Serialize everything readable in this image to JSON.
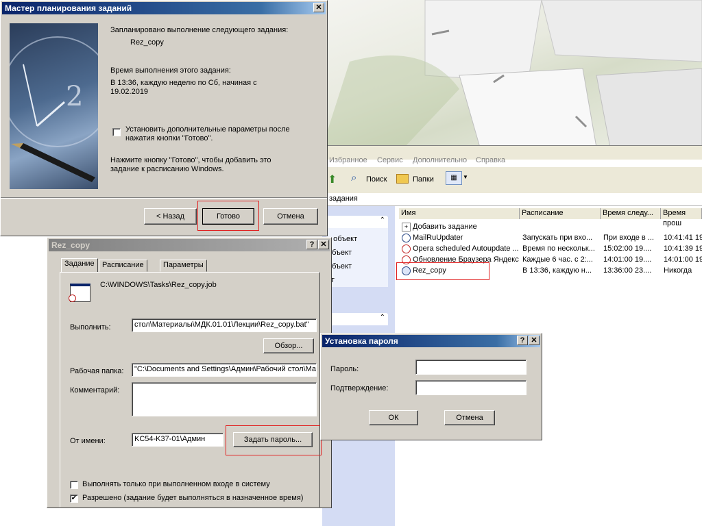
{
  "wizard": {
    "title": "Мастер планирования заданий",
    "close_glyph": "✕",
    "scheduled_text": "Запланировано выполнение следующего задания:",
    "task_name": "Rez_copy",
    "time_heading": "Время выполнения этого задания:",
    "time_line1": "В 13:36, каждую неделю по Сб, начиная с",
    "time_line2": "19.02.2019",
    "advanced_line1": "Установить дополнительные параметры после",
    "advanced_line2": "нажатия кнопки \"Готово\".",
    "hint_line1": "Нажмите кнопку \"Готово\", чтобы добавить это",
    "hint_line2": "задание к расписанию Windows.",
    "back_button": "< Назад",
    "finish_button": "Готово",
    "cancel_button": "Отмена"
  },
  "explorer": {
    "menu": [
      "Избранное",
      "Сервис",
      "Дополнительно",
      "Справка"
    ],
    "search_label": "Поиск",
    "folders_label": "Папки",
    "address": "задания",
    "left_items": [
      "т объект",
      "объект",
      "объект",
      "кт"
    ],
    "columns": [
      "Имя",
      "Расписание",
      "Время следу...",
      "Время прош"
    ],
    "rows": [
      {
        "name": "Добавить задание",
        "schedule": "",
        "next": "",
        "last": ""
      },
      {
        "name": "MailRuUpdater",
        "schedule": "Запускать при вхо...",
        "next": "При входе в ...",
        "last": "10:41:41  19"
      },
      {
        "name": "Opera scheduled Autoupdate ...",
        "schedule": "Время по нескольк...",
        "next": "15:02:00  19....",
        "last": "10:41:39  19"
      },
      {
        "name": "Обновление Браузера Яндекс",
        "schedule": "Каждые 6 час. с 2:...",
        "next": "14:01:00  19....",
        "last": "14:01:00  19"
      },
      {
        "name": "Rez_copy",
        "schedule": "В 13:36, каждую н...",
        "next": "13:36:00  23....",
        "last": "Никогда"
      }
    ]
  },
  "props": {
    "title": "Rez_copy",
    "help_glyph": "?",
    "close_glyph": "✕",
    "tabs": [
      "Задание",
      "Расписание",
      "Параметры"
    ],
    "job_path": "C:\\WINDOWS\\Tasks\\Rez_copy.job",
    "run_label": "Выполнить:",
    "run_value": "стол\\Материалы\\МДК.01.01\\Лекции\\Rez_copy.bat\"",
    "browse_button": "Обзор...",
    "workdir_label": "Рабочая папка:",
    "workdir_value": "\"C:\\Documents and Settings\\Админ\\Рабочий стол\\Мат",
    "comment_label": "Комментарий:",
    "runas_label": "От имени:",
    "runas_value": "KC54-K37-01\\Админ",
    "set_password_button": "Задать пароль...",
    "only_logged_on": "Выполнять только при выполненном входе в систему",
    "enabled": "Разрешено (задание будет выполняться в назначенное время)",
    "check_mark": "✔"
  },
  "password": {
    "title": "Установка пароля",
    "help_glyph": "?",
    "close_glyph": "✕",
    "password_label": "Пароль:",
    "confirm_label": "Подтверждение:",
    "ok_button": "ОК",
    "cancel_button": "Отмена"
  },
  "colors": {
    "highlight_red": "#e02020",
    "title_blue": "#0a246a",
    "dialog_gray": "#d4d0c8"
  }
}
